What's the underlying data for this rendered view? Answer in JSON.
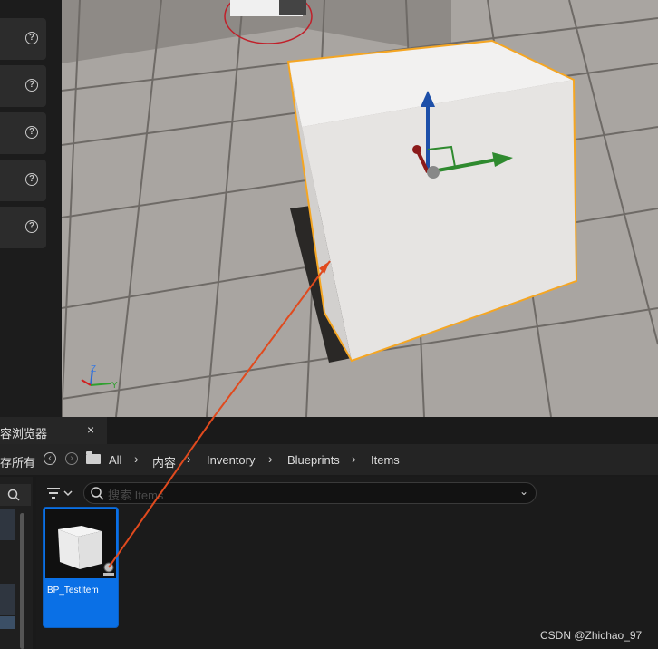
{
  "details_panel": {
    "help_rows": [
      {
        "icon": "help-icon",
        "glyph": "?"
      },
      {
        "icon": "help-icon",
        "glyph": "?"
      },
      {
        "icon": "help-icon",
        "glyph": "?"
      },
      {
        "icon": "help-icon",
        "glyph": "?"
      },
      {
        "icon": "help-icon",
        "glyph": "?"
      }
    ]
  },
  "viewport": {
    "selection_color": "#f5a623",
    "axis_labels": {
      "z": "Z",
      "y": "Y"
    }
  },
  "content_browser": {
    "tab_label": "容浏览器",
    "close_glyph": "×",
    "save_all_label": "存所有",
    "breadcrumbs": [
      "All",
      "内容",
      "Inventory",
      "Blueprints",
      "Items"
    ],
    "search_placeholder": "搜索 Items",
    "asset": {
      "name": "BP_TestItem"
    },
    "accent": "#0a70e6"
  },
  "watermark": "CSDN @Zhichao_97"
}
